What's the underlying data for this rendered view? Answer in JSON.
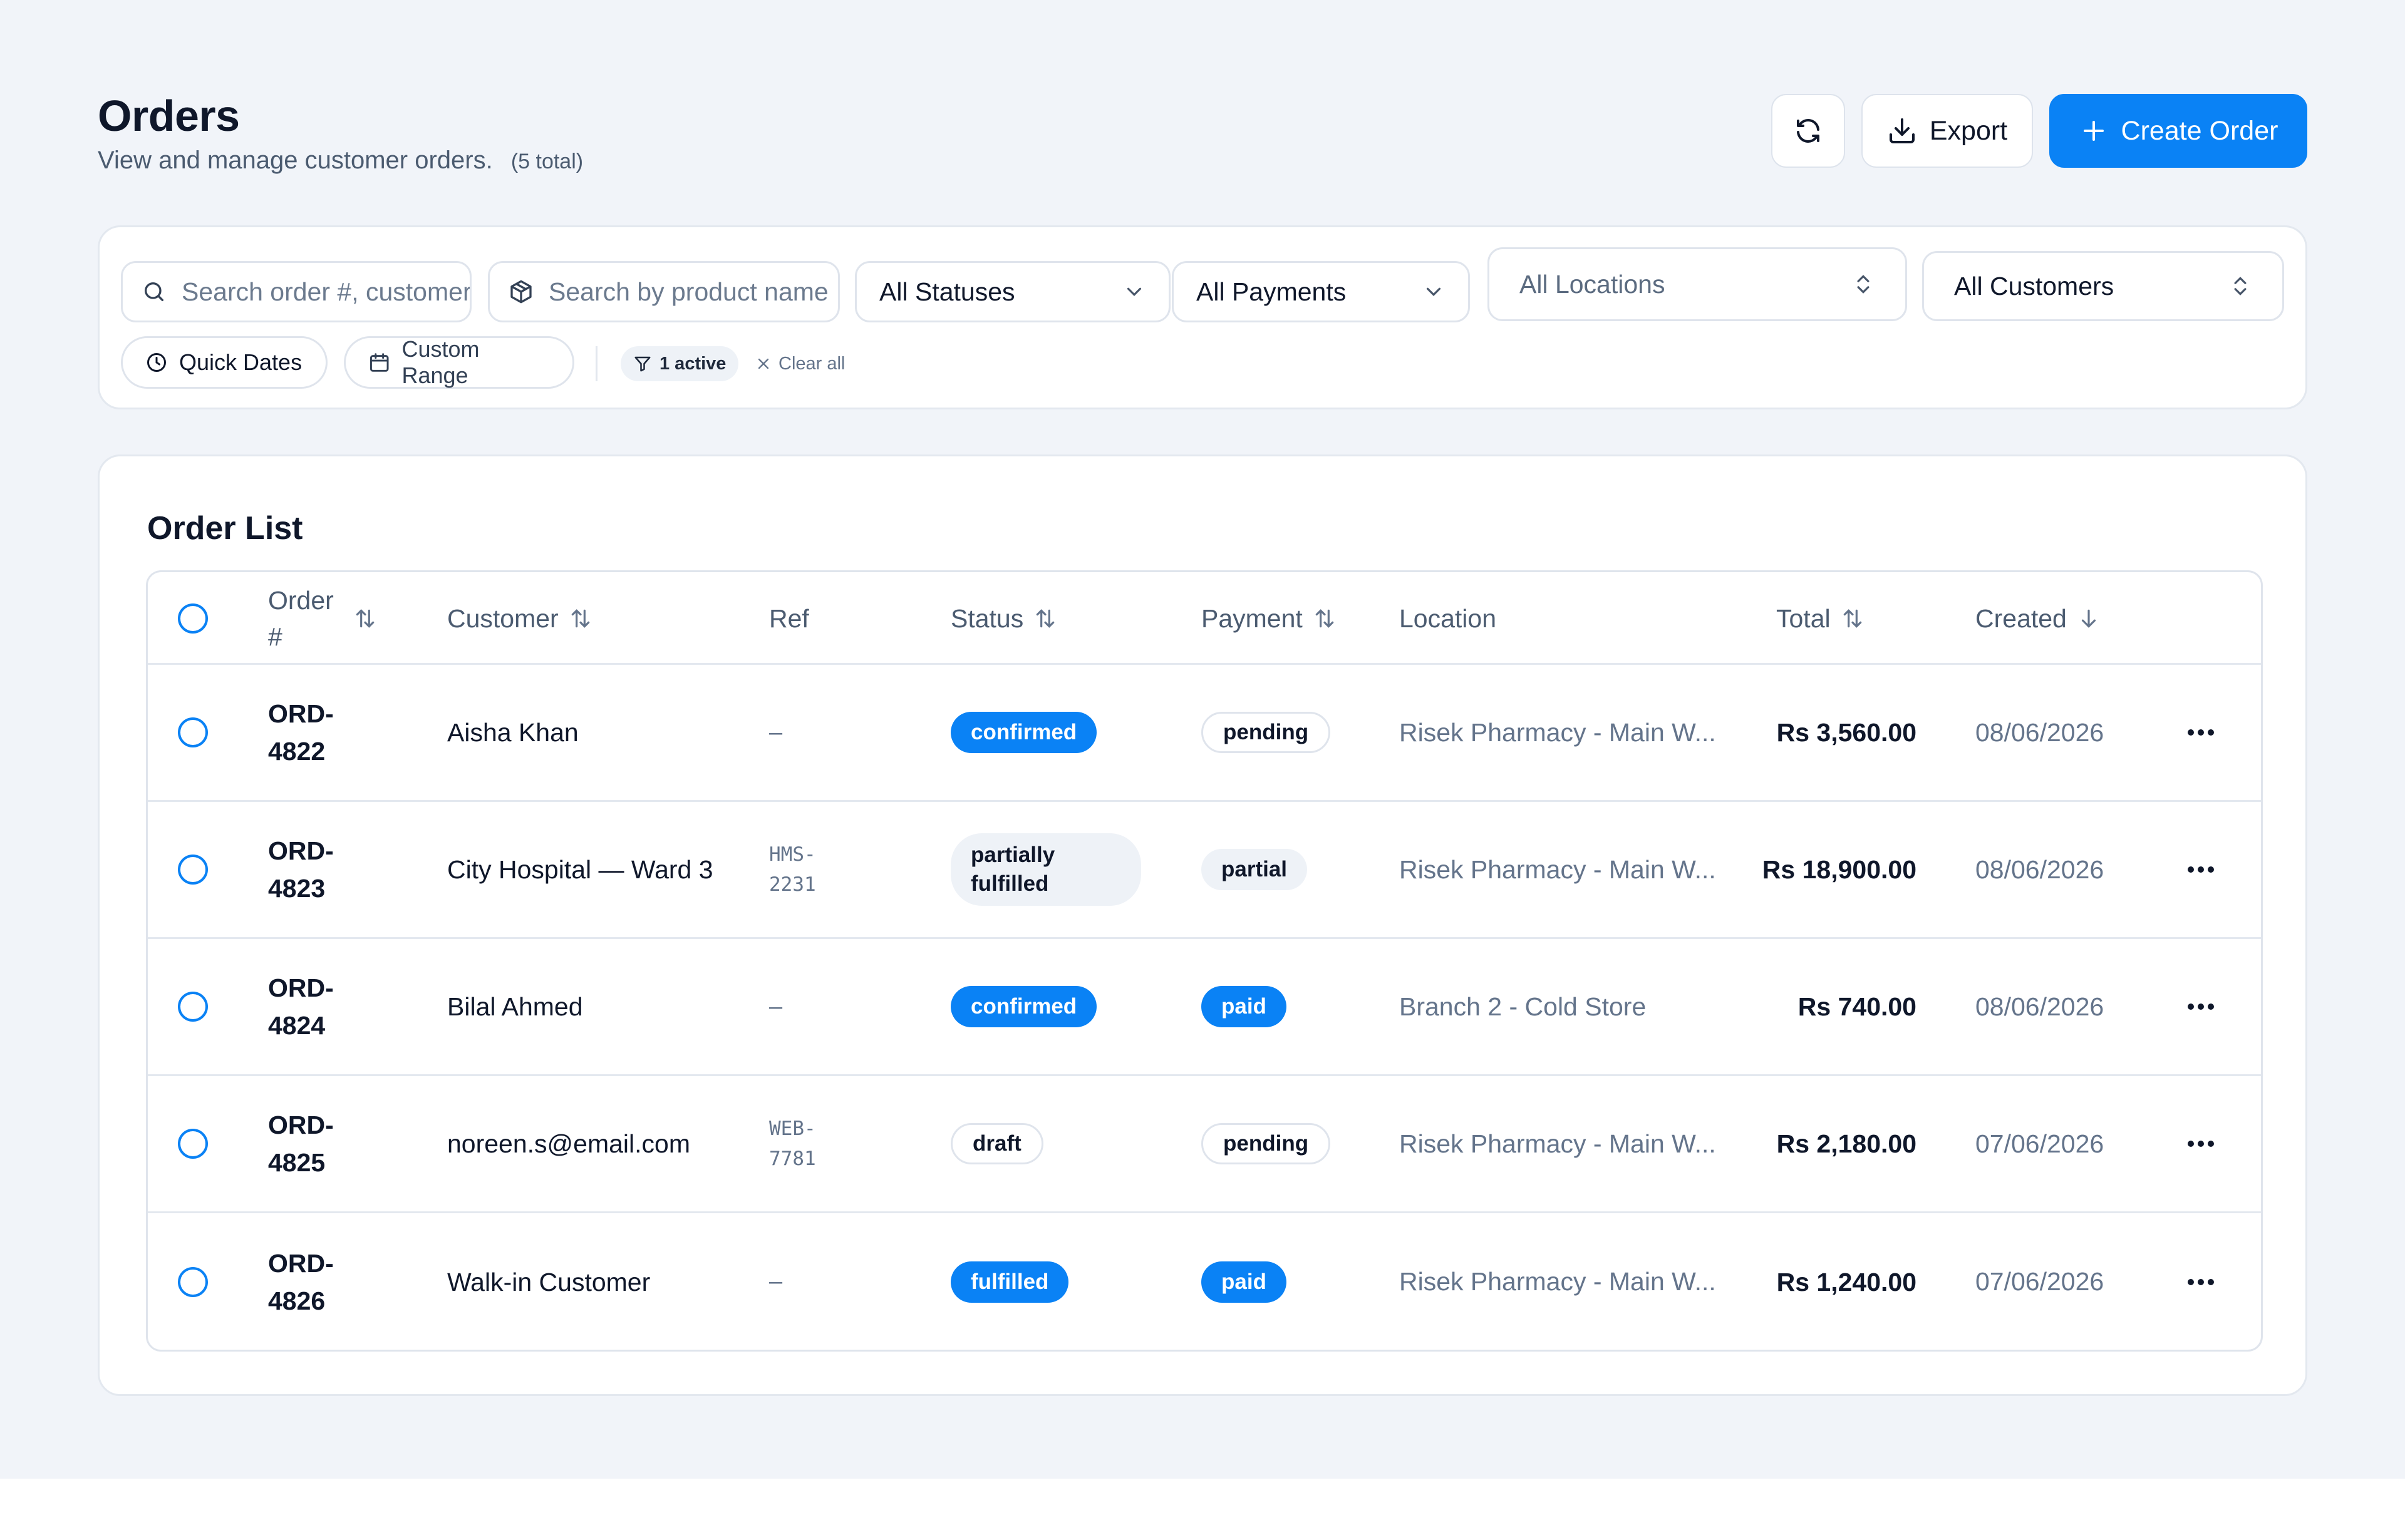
{
  "header": {
    "title": "Orders",
    "subtitle": "View and manage customer orders.",
    "count": "(5 total)",
    "export_label": "Export",
    "create_label": "Create Order"
  },
  "filters": {
    "search_placeholder": "Search order #, customer",
    "product_placeholder": "Search by product name",
    "status": "All Statuses",
    "payment": "All Payments",
    "location": "All Locations",
    "customer": "All Customers",
    "quick_dates": "Quick Dates",
    "custom_range": "Custom Range",
    "active": "1 active",
    "clear_all": "Clear all"
  },
  "order_list": {
    "title": "Order List",
    "columns": {
      "order": "Order #",
      "customer": "Customer",
      "ref": "Ref",
      "status": "Status",
      "payment": "Payment",
      "location": "Location",
      "total": "Total",
      "created": "Created"
    },
    "rows": [
      {
        "order": "ORD-4822",
        "customer": "Aisha Khan",
        "ref": "–",
        "status": "confirmed",
        "payment": "pending",
        "location": "Risek Pharmacy - Main W...",
        "total": "Rs 3,560.00",
        "created": "08/06/2026"
      },
      {
        "order": "ORD-4823",
        "customer": "City Hospital — Ward 3",
        "ref": "HMS-2231",
        "status": "partially fulfilled",
        "payment": "partial",
        "location": "Risek Pharmacy - Main W...",
        "total": "Rs 18,900.00",
        "created": "08/06/2026"
      },
      {
        "order": "ORD-4824",
        "customer": "Bilal Ahmed",
        "ref": "–",
        "status": "confirmed",
        "payment": "paid",
        "location": "Branch 2 - Cold Store",
        "total": "Rs 740.00",
        "created": "08/06/2026"
      },
      {
        "order": "ORD-4825",
        "customer": "noreen.s@email.com",
        "ref": "WEB-7781",
        "status": "draft",
        "payment": "pending",
        "location": "Risek Pharmacy - Main W...",
        "total": "Rs 2,180.00",
        "created": "07/06/2026"
      },
      {
        "order": "ORD-4826",
        "customer": "Walk-in Customer",
        "ref": "–",
        "status": "fulfilled",
        "payment": "paid",
        "location": "Risek Pharmacy - Main W...",
        "total": "Rs 1,240.00",
        "created": "07/06/2026"
      }
    ]
  },
  "colors": {
    "accent": "#0a82f5",
    "background": "#f1f4f9"
  }
}
